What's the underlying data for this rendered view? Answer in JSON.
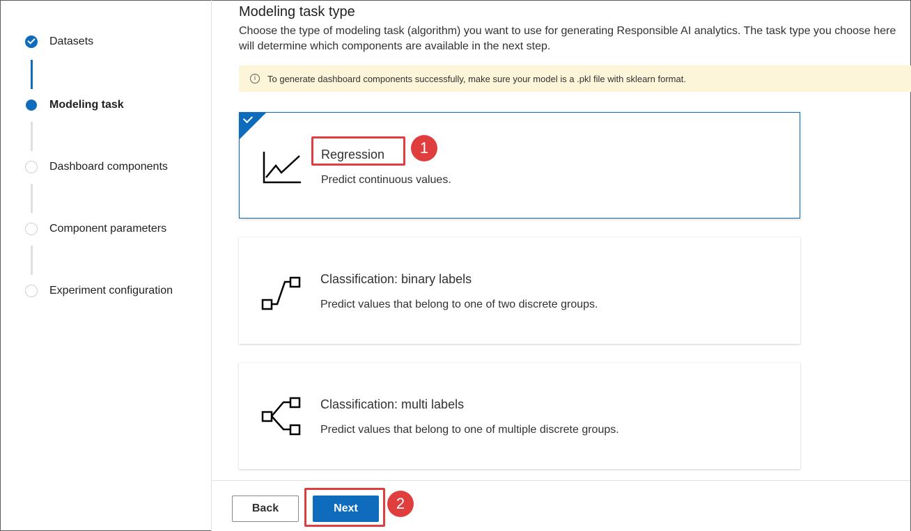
{
  "sidebar": {
    "steps": [
      {
        "label": "Datasets",
        "status": "done"
      },
      {
        "label": "Modeling task",
        "status": "current"
      },
      {
        "label": "Dashboard components",
        "status": "todo"
      },
      {
        "label": "Component parameters",
        "status": "todo"
      },
      {
        "label": "Experiment configuration",
        "status": "todo"
      }
    ]
  },
  "main": {
    "title": "Modeling task type",
    "description": "Choose the type of modeling task (algorithm) you want to use for generating Responsible AI analytics. The task type you choose here will determine which components are available in the next step.",
    "banner": {
      "icon": "info-icon",
      "text": "To generate dashboard components successfully, make sure your model is a .pkl file with sklearn format."
    },
    "options": [
      {
        "title": "Regression",
        "subtitle": "Predict continuous values.",
        "icon": "line-chart-icon",
        "selected": true
      },
      {
        "title": "Classification: binary labels",
        "subtitle": "Predict values that belong to one of two discrete groups.",
        "icon": "binary-classification-icon",
        "selected": false
      },
      {
        "title": "Classification: multi labels",
        "subtitle": "Predict values that belong to one of multiple discrete groups.",
        "icon": "multi-classification-icon",
        "selected": false
      }
    ]
  },
  "footer": {
    "back_label": "Back",
    "next_label": "Next"
  },
  "annotations": {
    "badge_1": "1",
    "badge_2": "2"
  },
  "colors": {
    "accent": "#0f6cbd",
    "highlight": "#e03e3e",
    "banner_bg": "#fcf5d9"
  }
}
